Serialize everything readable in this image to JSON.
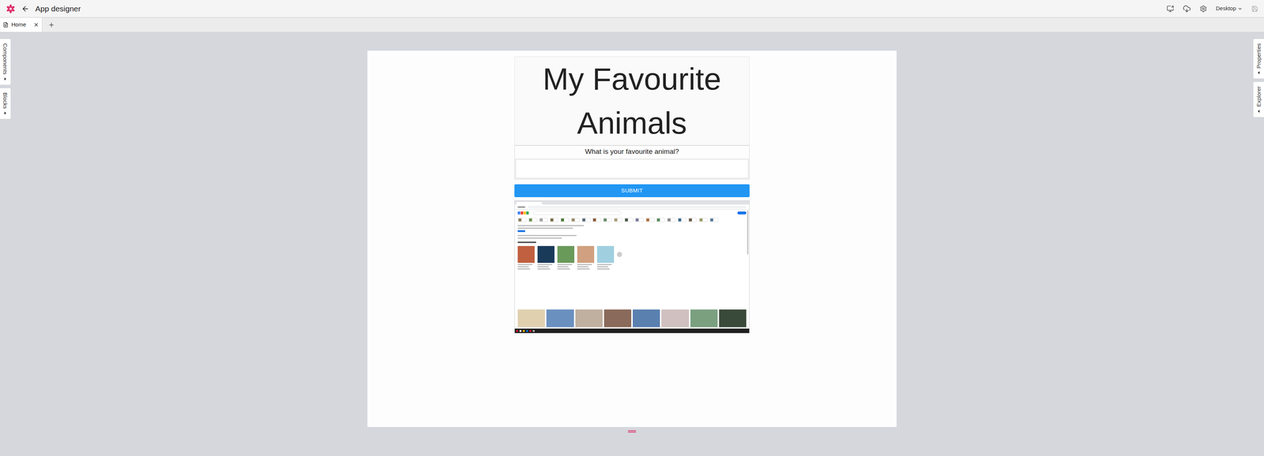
{
  "app": {
    "title": "App designer",
    "device": "Desktop"
  },
  "tabs": [
    {
      "label": "Home",
      "selected": true
    }
  ],
  "left_panels": [
    {
      "label": "Components"
    },
    {
      "label": "Blocks"
    }
  ],
  "right_panels": [
    {
      "label": "Properties"
    },
    {
      "label": "Explorer"
    }
  ],
  "page": {
    "heading": "My Favourite Animals",
    "question": "What is your favourite animal?",
    "input_value": "",
    "button": "SUBMIT"
  }
}
